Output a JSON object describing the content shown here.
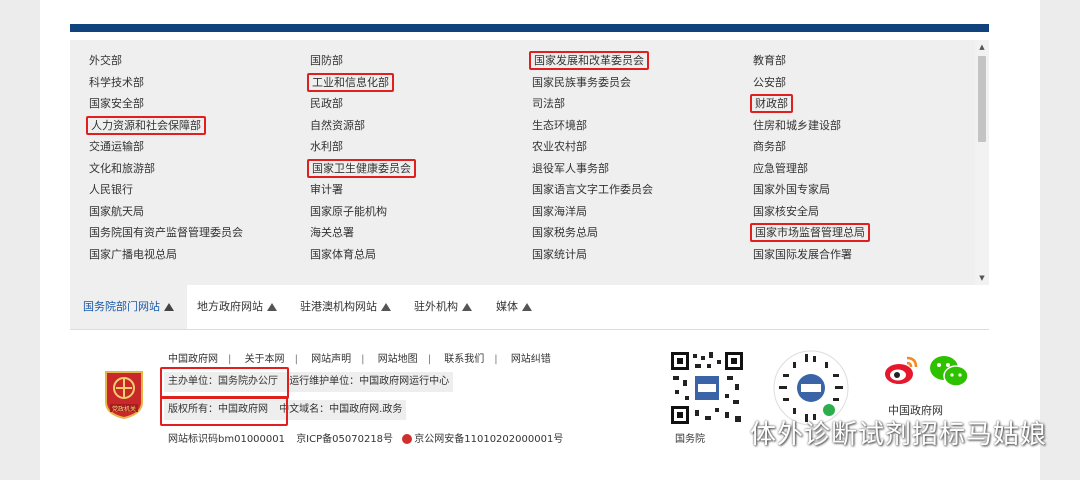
{
  "departments": {
    "col0": [
      {
        "label": "外交部",
        "hl": false
      },
      {
        "label": "科学技术部",
        "hl": false
      },
      {
        "label": "国家安全部",
        "hl": false
      },
      {
        "label": "人力资源和社会保障部",
        "hl": true
      },
      {
        "label": "交通运输部",
        "hl": false
      },
      {
        "label": "文化和旅游部",
        "hl": false
      },
      {
        "label": "人民银行",
        "hl": false
      },
      {
        "label": "国家航天局",
        "hl": false
      },
      {
        "label": "国务院国有资产监督管理委员会",
        "hl": false
      },
      {
        "label": "国家广播电视总局",
        "hl": false
      }
    ],
    "col1": [
      {
        "label": "国防部",
        "hl": false
      },
      {
        "label": "工业和信息化部",
        "hl": true
      },
      {
        "label": "民政部",
        "hl": false
      },
      {
        "label": "自然资源部",
        "hl": false
      },
      {
        "label": "水利部",
        "hl": false
      },
      {
        "label": "国家卫生健康委员会",
        "hl": true
      },
      {
        "label": "审计署",
        "hl": false
      },
      {
        "label": "国家原子能机构",
        "hl": false
      },
      {
        "label": "海关总署",
        "hl": false
      },
      {
        "label": "国家体育总局",
        "hl": false
      }
    ],
    "col2": [
      {
        "label": "国家发展和改革委员会",
        "hl": true
      },
      {
        "label": "国家民族事务委员会",
        "hl": false
      },
      {
        "label": "司法部",
        "hl": false
      },
      {
        "label": "生态环境部",
        "hl": false
      },
      {
        "label": "农业农村部",
        "hl": false
      },
      {
        "label": "退役军人事务部",
        "hl": false
      },
      {
        "label": "国家语言文字工作委员会",
        "hl": false
      },
      {
        "label": "国家海洋局",
        "hl": false
      },
      {
        "label": "国家税务总局",
        "hl": false
      },
      {
        "label": "国家统计局",
        "hl": false
      }
    ],
    "col3": [
      {
        "label": "教育部",
        "hl": false
      },
      {
        "label": "公安部",
        "hl": false
      },
      {
        "label": "财政部",
        "hl": true
      },
      {
        "label": "住房和城乡建设部",
        "hl": false
      },
      {
        "label": "商务部",
        "hl": false
      },
      {
        "label": "应急管理部",
        "hl": false
      },
      {
        "label": "国家外国专家局",
        "hl": false
      },
      {
        "label": "国家核安全局",
        "hl": false
      },
      {
        "label": "国家市场监督管理总局",
        "hl": true
      },
      {
        "label": "国家国际发展合作署",
        "hl": false
      }
    ]
  },
  "tabs": [
    {
      "label": "国务院部门网站",
      "active": true
    },
    {
      "label": "地方政府网站",
      "active": false
    },
    {
      "label": "驻港澳机构网站",
      "active": false
    },
    {
      "label": "驻外机构",
      "active": false
    },
    {
      "label": "媒体",
      "active": false
    }
  ],
  "footer": {
    "nav": [
      "中国政府网",
      "关于本网",
      "网站声明",
      "网站地图",
      "联系我们",
      "网站纠错"
    ],
    "sponsor": "主办单位：国务院办公厅",
    "operator": "运行维护单位：中国政府网运行中心",
    "copyright": "版权所有：中国政府网",
    "domain": "中文域名：中国政府网.政务",
    "site_id": "网站标识码bm01000001",
    "icp": "京ICP备05070218号",
    "police": "京公网安备11010202000001号",
    "emblem_text": "党政机关",
    "qr1_label": "国务院",
    "qr2_label": "",
    "brand": "中国政府网"
  },
  "watermark": "体外诊断试剂招标马姑娘",
  "colors": {
    "topbar": "#10427d",
    "highlight": "#e0201e",
    "active_tab": "#1a5aa8"
  }
}
